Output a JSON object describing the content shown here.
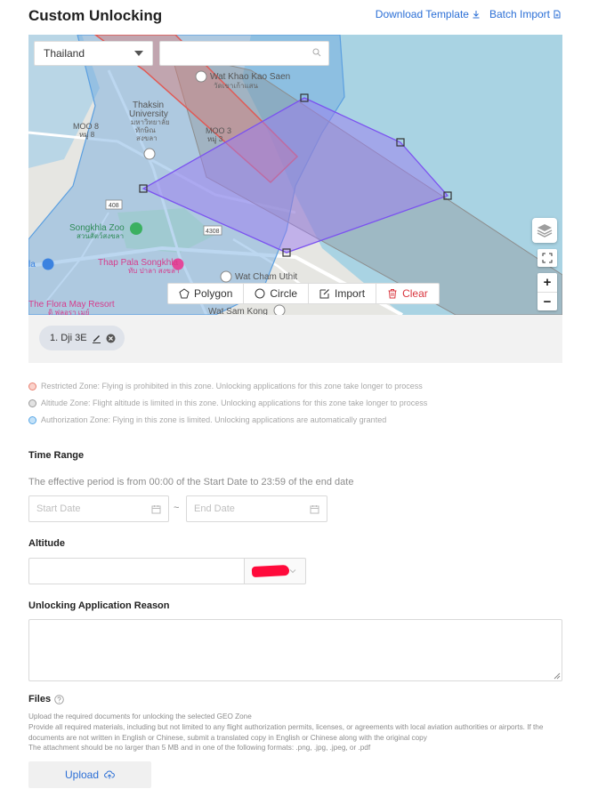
{
  "header": {
    "title": "Custom Unlocking",
    "download_template": "Download Template",
    "batch_import": "Batch Import"
  },
  "map": {
    "country": "Thailand",
    "search_placeholder": "",
    "labels": {
      "wat_khao": "Wat Khao Kao Saen",
      "wat_khao_th": "วัดเขาเก้าแสน",
      "thaksin1": "Thaksin",
      "thaksin2": "University",
      "thaksin_th1": "มหาวิทยาลัย",
      "thaksin_th2": "ทักษิณ",
      "thaksin_th3": "สงขลา",
      "moo8": "MOO 8",
      "moo8_th": "หมู่ 8",
      "moo3": "MOO 3",
      "moo3_th": "หมู่ 3",
      "zoo": "Songkhla Zoo",
      "zoo_th": "สวนสัตว์สงขลา",
      "thap_pala": "Thap Pala Songkhla",
      "thap_pala_th": "ทับ ปาลา สงขลา",
      "wat_cham": "Wat Cham Uthit",
      "flora": "The Flora May Resort",
      "flora_th": "ดิ ฟลอรา เมย์",
      "wat_sam": "Wat Sam Kong",
      "la": "la",
      "road_408": "408",
      "road_4308": "4308"
    },
    "tools": {
      "polygon": "Polygon",
      "circle": "Circle",
      "import": "Import",
      "clear": "Clear"
    },
    "zoom_in": "+",
    "zoom_out": "−"
  },
  "zones": [
    {
      "label": "1. Dji 3E"
    }
  ],
  "legend": {
    "restricted": "Restricted Zone: Flying is prohibited in this zone. Unlocking applications for this zone take longer to process",
    "altitude": "Altitude Zone: Flight altitude is limited in this zone. Unlocking applications for this zone take longer to process",
    "authorization": "Authorization Zone: Flying in this zone is limited. Unlocking applications are automatically granted",
    "colors": {
      "restricted": "#f2a193",
      "altitude": "#bdbdbd",
      "authorization": "#86c1ee"
    }
  },
  "time_range": {
    "label": "Time Range",
    "helper": "The effective period is from 00:00 of the Start Date to 23:59 of the end date",
    "start_placeholder": "Start Date",
    "end_placeholder": "End Date",
    "separator": "~"
  },
  "altitude": {
    "label": "Altitude",
    "value": ""
  },
  "reason": {
    "label": "Unlocking Application Reason",
    "value": ""
  },
  "files": {
    "label": "Files",
    "desc1": "Upload the required documents for unlocking the selected GEO Zone",
    "desc2": "Provide all required materials, including but not limited to any flight authorization permits, licenses, or agreements with local aviation authorities or airports. If the documents are not written in English or Chinese, submit a translated copy in English or Chinese along with the original copy",
    "desc3": "The attachment should be no larger than 5 MB and in one of the following formats: .png, .jpg, .jpeg, or .pdf",
    "upload": "Upload"
  },
  "colors": {
    "accent": "#2b6fd6",
    "danger": "#d9363e"
  }
}
